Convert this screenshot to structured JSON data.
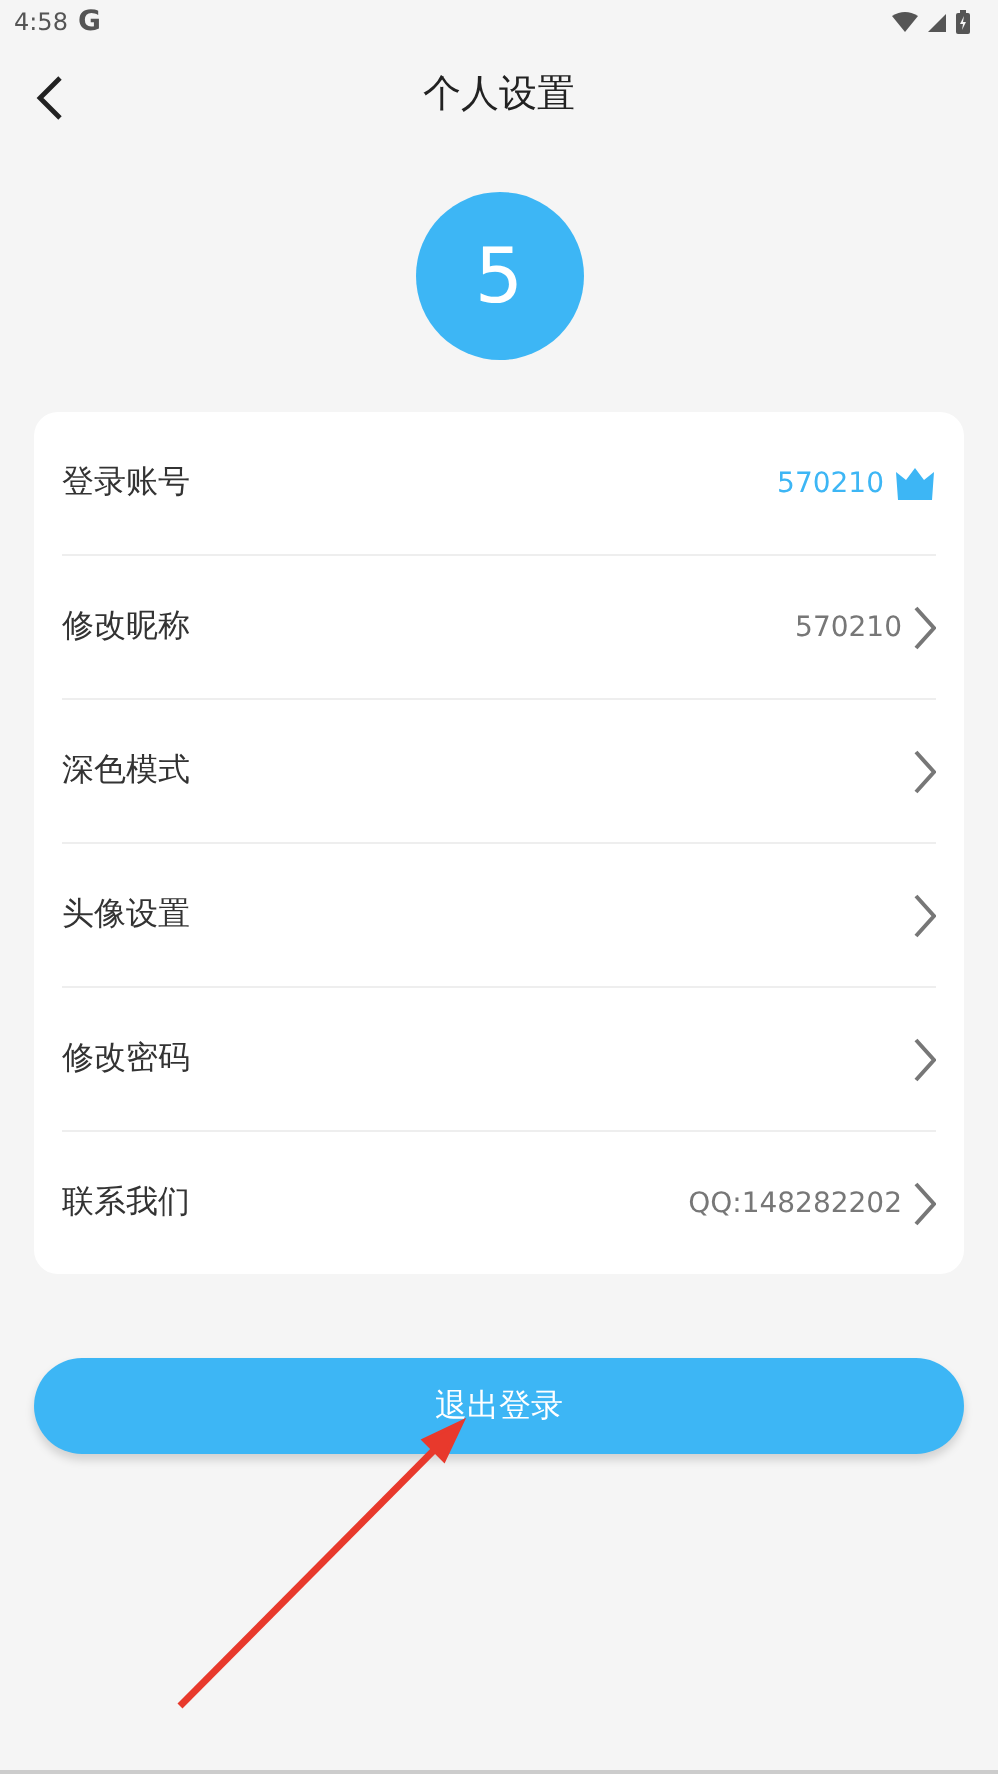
{
  "status_bar": {
    "time": "4:58",
    "app_glyph": "G"
  },
  "header": {
    "title": "个人设置"
  },
  "avatar": {
    "text": "5"
  },
  "settings": [
    {
      "label": "登录账号",
      "value": "570210",
      "kind": "vip"
    },
    {
      "label": "修改昵称",
      "value": "570210",
      "kind": "link"
    },
    {
      "label": "深色模式",
      "kind": "link"
    },
    {
      "label": "头像设置",
      "kind": "link"
    },
    {
      "label": "修改密码",
      "kind": "link"
    },
    {
      "label": "联系我们",
      "value": "QQ:148282202",
      "kind": "link"
    }
  ],
  "logout_button": {
    "label": "退出登录"
  },
  "annotation": {
    "kind": "arrow"
  }
}
